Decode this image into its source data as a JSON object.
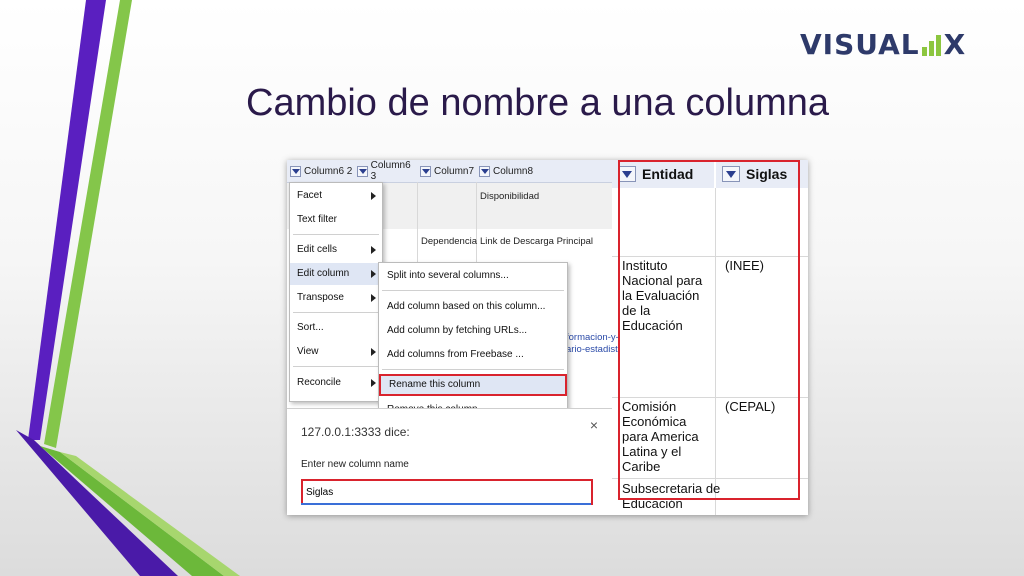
{
  "logo": {
    "pre": "VISUAL",
    "post": "X"
  },
  "slide_title": "Cambio de nombre a una columna",
  "grid": {
    "columns": [
      "Column6 2",
      "Column6 3",
      "Column7",
      "Column8"
    ],
    "cells": {
      "disponibilidad": "Disponibilidad",
      "dependencia": "Dependencia",
      "link": "Link de Descarga Principal",
      "url1": "formacion-y-",
      "url2": "ario-estadisti"
    }
  },
  "menu": {
    "items": [
      "Facet",
      "Text filter",
      "Edit cells",
      "Edit column",
      "Transpose",
      "Sort...",
      "View",
      "Reconcile"
    ]
  },
  "submenu": {
    "items": [
      "Split into several columns...",
      "Add column based on this column...",
      "Add column by fetching URLs...",
      "Add columns from Freebase ...",
      "Rename this column",
      "Remove this column"
    ]
  },
  "dialog": {
    "title": "127.0.0.1:3333 dice:",
    "close": "×",
    "label": "Enter new column name",
    "value": "Siglas"
  },
  "result_table": {
    "headers": [
      "Entidad",
      "Siglas"
    ],
    "rows": [
      {
        "entidad": "Instituto Nacional para la Evaluación de la Educación",
        "siglas": "(INEE)"
      },
      {
        "entidad": "Comisión Económica para America Latina y el Caribe",
        "siglas": "(CEPAL)"
      },
      {
        "entidad": "Subsecretaria de Educación",
        "siglas": ""
      }
    ]
  },
  "colors": {
    "accent_red": "#d9232d",
    "menu_highlight": "#dfe6f4",
    "title": "#2a1a4a",
    "logo_navy": "#2e3a6a",
    "logo_green": "#8cc63f",
    "deco_purple": "#5a1fc0",
    "deco_green": "#7fc241"
  }
}
